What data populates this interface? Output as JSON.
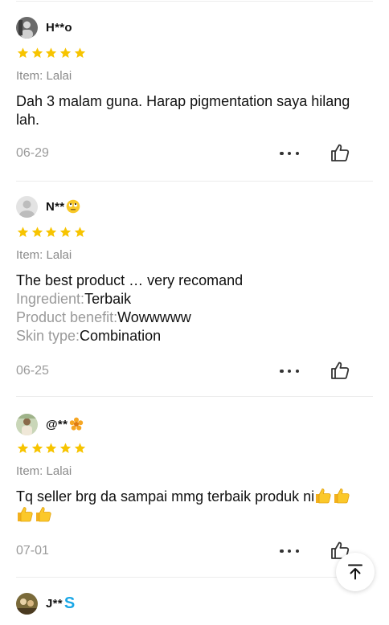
{
  "reviews": [
    {
      "username": "H**o",
      "rating": 5,
      "item_label": "Item: Lalai",
      "text": "Dah 3 malam guna. Harap pigmentation saya hilang lah.",
      "date": "06-29"
    },
    {
      "username": "N**",
      "name_emoji": "🙄",
      "rating": 5,
      "item_label": "Item: Lalai",
      "text": "The best product … very recomand",
      "attributes": [
        {
          "key": "Ingredient:",
          "value": "Terbaik"
        },
        {
          "key": "Product benefit:",
          "value": "Wowwwww"
        },
        {
          "key": "Skin type:",
          "value": "Combination"
        }
      ],
      "date": "06-25"
    },
    {
      "username": "@**",
      "name_emoji": "🌼",
      "rating": 5,
      "item_label": "Item: Lalai",
      "text": "Tq seller brg da sampai mmg terbaik produk ni",
      "text_emojis": [
        "thumbs-up",
        "thumbs-up",
        "thumbs-up",
        "thumbs-up"
      ],
      "date": "07-01"
    },
    {
      "username": "J**",
      "name_emoji": "S"
    }
  ],
  "icons": {
    "star": "star-icon",
    "more": "more-dots-icon",
    "like": "thumbs-up-outline-icon",
    "back_to_top": "arrow-up-to-top-icon"
  },
  "colors": {
    "star": "#f7c400",
    "name_emoji_s": "#1aa7e6"
  }
}
